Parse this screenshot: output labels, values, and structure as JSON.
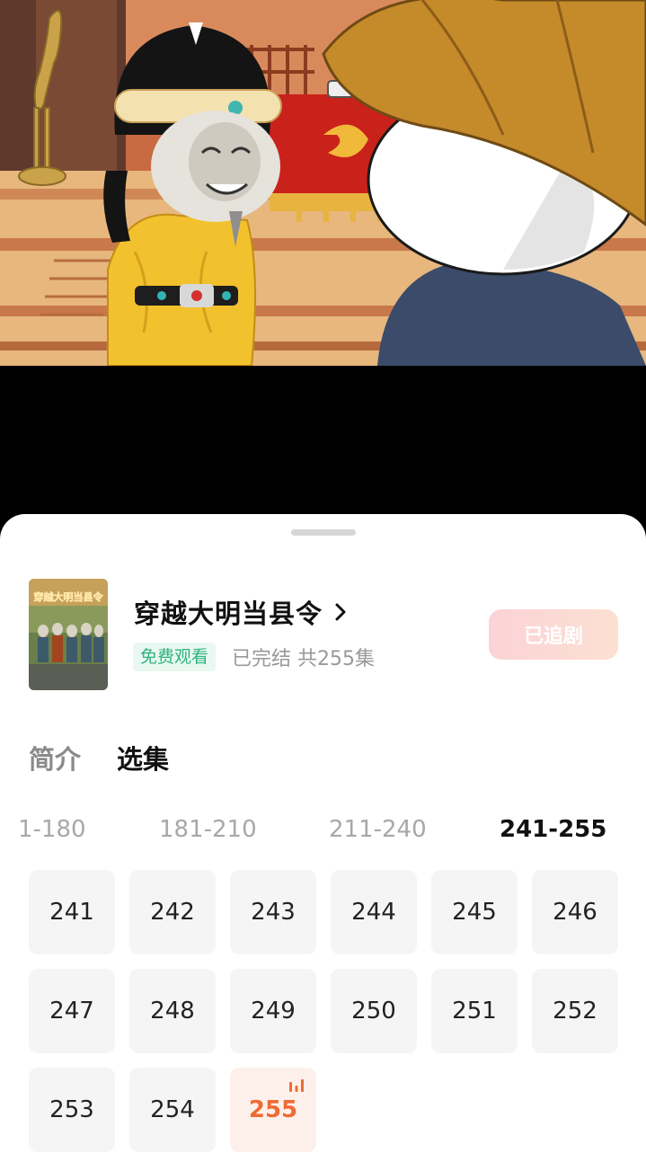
{
  "drama": {
    "title": "穿越大明当县令",
    "poster_text": "穿越大明当县令",
    "free_badge": "免费观看",
    "status": "已完结 共255集",
    "follow_label": "已追剧"
  },
  "tabs": [
    {
      "label": "简介",
      "active": false
    },
    {
      "label": "选集",
      "active": true
    }
  ],
  "ranges": [
    {
      "label": "1-180",
      "active": false
    },
    {
      "label": "181-210",
      "active": false
    },
    {
      "label": "211-240",
      "active": false
    },
    {
      "label": "241-255",
      "active": true
    }
  ],
  "episodes": [
    "241",
    "242",
    "243",
    "244",
    "245",
    "246",
    "247",
    "248",
    "249",
    "250",
    "251",
    "252",
    "253",
    "254",
    "255"
  ],
  "current_episode": "255",
  "colors": {
    "accent": "#f06a35",
    "free_badge_text": "#2fb37e",
    "follow_button": "#fbd3d7"
  },
  "icons": {
    "title_arrow": "chevron-right-icon",
    "playing": "playing-bars-icon"
  }
}
